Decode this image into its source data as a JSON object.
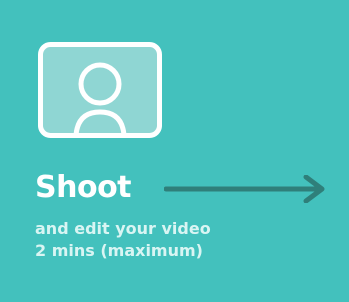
{
  "card": {
    "title": "Shoot",
    "subtitle_line1": "and edit your video",
    "subtitle_line2": "2 mins (maximum)"
  },
  "icons": {
    "camera": "webcam-person-icon",
    "arrow": "right-arrow-icon"
  },
  "colors": {
    "background": "#43c1bd",
    "arrow": "#2f7f7a",
    "text": "#ffffff"
  }
}
